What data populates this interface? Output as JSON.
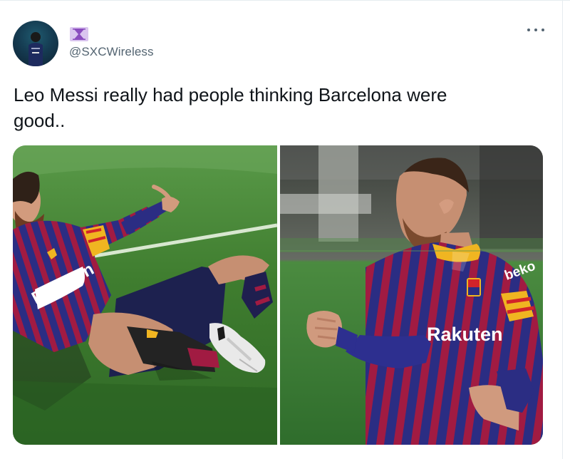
{
  "tweet": {
    "author_handle": "@SXCWireless",
    "author_name_icon": "hourglass-emoji-icon",
    "text": "Leo Messi really had people thinking Barcelona were\ngood..",
    "more_icon": "more-options-icon"
  },
  "media": {
    "images": [
      {
        "name": "messi-sliding-celebration"
      },
      {
        "name": "messi-fist-pump-celebration"
      }
    ],
    "jersey_text_left": "Rakuten",
    "jersey_text_right": "Rakuten",
    "sleeve_text_right": "beko"
  },
  "colors": {
    "handle": "#536471",
    "text": "#0f1419",
    "grass": "#3d7f2f",
    "barca_blue": "#2a2a80",
    "barca_red": "#a41f3f"
  }
}
